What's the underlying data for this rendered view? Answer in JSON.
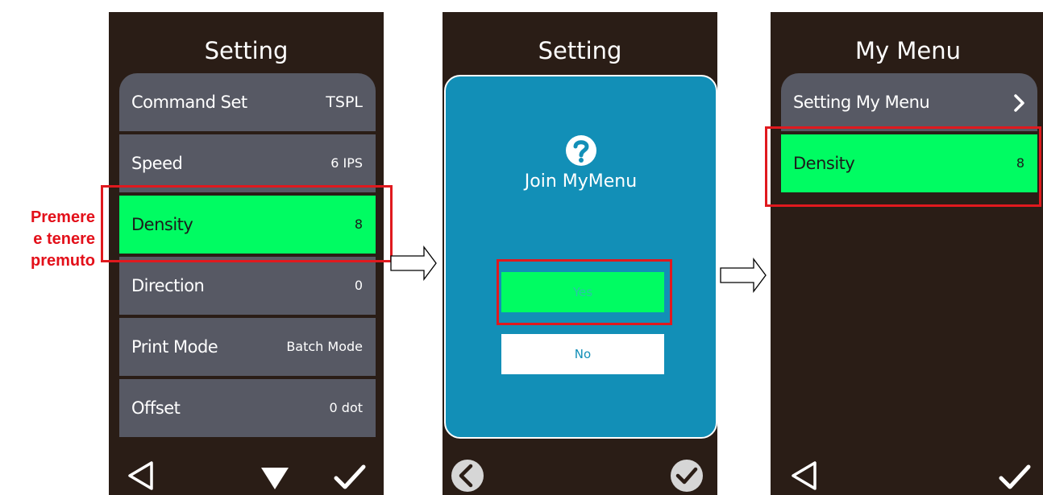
{
  "screen1": {
    "title": "Setting",
    "items": [
      {
        "label": "Command Set",
        "value": "TSPL"
      },
      {
        "label": "Speed",
        "value": "6 IPS"
      },
      {
        "label": "Density",
        "value": "8"
      },
      {
        "label": "Direction",
        "value": "0"
      },
      {
        "label": "Print Mode",
        "value": "Batch Mode"
      },
      {
        "label": "Offset",
        "value": "0 dot"
      }
    ],
    "highlighted_item": "Density",
    "nav_icons": [
      "back-triangle-icon",
      "down-triangle-icon",
      "check-icon"
    ]
  },
  "annotation": {
    "line1": "Premere",
    "line2": "e tenere",
    "line3": "premuto"
  },
  "screen2": {
    "title": "Setting",
    "dialog": {
      "icon": "question-icon",
      "message": "Join MyMenu",
      "yes_label": "Yes",
      "no_label": "No"
    },
    "nav_icons": [
      "back-circle-icon",
      "check-circle-icon"
    ]
  },
  "screen3": {
    "title": "My Menu",
    "items": [
      {
        "label": "Setting My Menu",
        "icon": "chevron-right-icon"
      },
      {
        "label": "Density",
        "value": "8"
      }
    ],
    "nav_icons": [
      "back-triangle-icon",
      "check-icon"
    ]
  },
  "colors": {
    "screen_bg": "#2a1d16",
    "row_bg": "#575964",
    "active_green": "#00fc62",
    "dialog_blue": "#128fb7",
    "highlight_red": "#e0191e"
  }
}
